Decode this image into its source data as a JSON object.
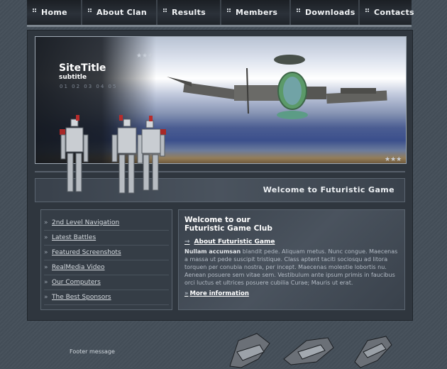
{
  "nav": {
    "items": [
      "Home",
      "About Clan",
      "Results",
      "Members",
      "Downloads",
      "Contacts"
    ]
  },
  "banner": {
    "site_title": "SiteTitle",
    "subtitle": "subtitle",
    "numbers": "01 02 03 04 05"
  },
  "welcome": {
    "title": "Welcome to Futuristic Game"
  },
  "sidebar": {
    "items": [
      "2nd Level Navigation",
      "Latest Battles",
      "Featured Screenshots",
      "RealMedia Video",
      "Our Computers",
      "The Best Sponsors"
    ]
  },
  "main": {
    "title_line1": "Welcome to our",
    "title_line2": "Futuristic Game Club",
    "link": "About Futuristic Game",
    "body_bold": "Nullam accumsan",
    "body": " blandit pede. Aliquam metus. Nunc congue. Maecenas a massa ut pede suscipit tristique. Class aptent taciti sociosqu ad litora torquen per conubia nostra, per incept. Maecenas molestie lobortis nu. Aenean posuere sem vitae sem. Vestibulum ante ipsum primis in faucibus orci luctus et ultrices posuere cubilia Curae; Mauris ut erat.",
    "more": "More information"
  },
  "footer": {
    "message": "Footer message"
  }
}
